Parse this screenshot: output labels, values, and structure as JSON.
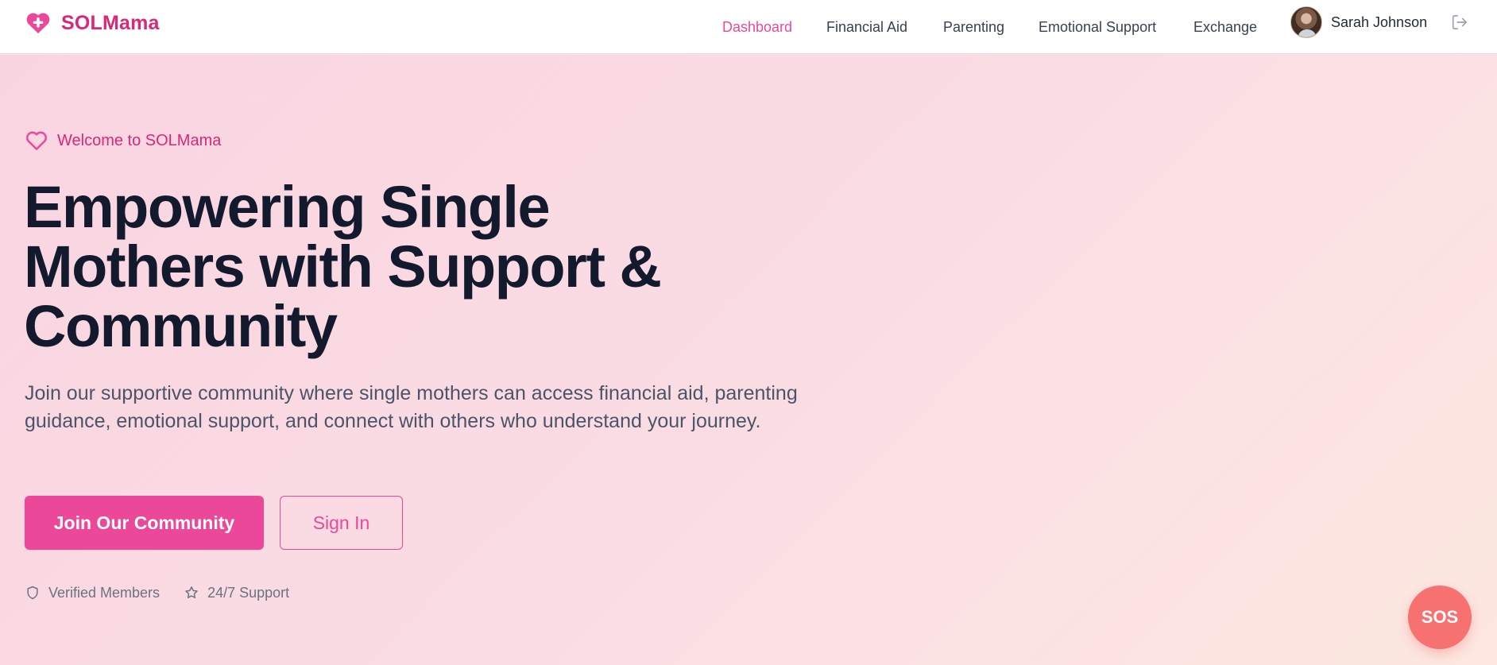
{
  "brand": {
    "name": "SOLMama",
    "icon": "heart-plus-icon",
    "color": "#db2777"
  },
  "nav": {
    "items": [
      {
        "label": "Dashboard",
        "active": true
      },
      {
        "label": "Financial Aid",
        "active": false
      },
      {
        "label": "Parenting",
        "active": false
      },
      {
        "label": "Emotional Support",
        "active": false
      },
      {
        "label": "Exchange",
        "active": false
      }
    ],
    "active_color": "#ec4899"
  },
  "user": {
    "name": "Sarah Johnson",
    "logout_icon": "logout-icon"
  },
  "hero": {
    "eyebrow": "Welcome to SOLMama",
    "headline": "Empowering Single Mothers with Support & Community",
    "lead": "Join our supportive community where single mothers can access financial aid, parenting guidance, emotional support, and connect with others who understand your journey.",
    "primary_button": "Join Our Community",
    "secondary_button": "Sign In",
    "features": [
      {
        "icon": "shield-icon",
        "label": "Verified Members"
      },
      {
        "icon": "star-icon",
        "label": "24/7 Support"
      }
    ]
  },
  "sos": {
    "label": "SOS",
    "color": "#f87171"
  },
  "colors": {
    "accent": "#ec4899",
    "heading": "#131a2e",
    "body": "#4b5468"
  }
}
